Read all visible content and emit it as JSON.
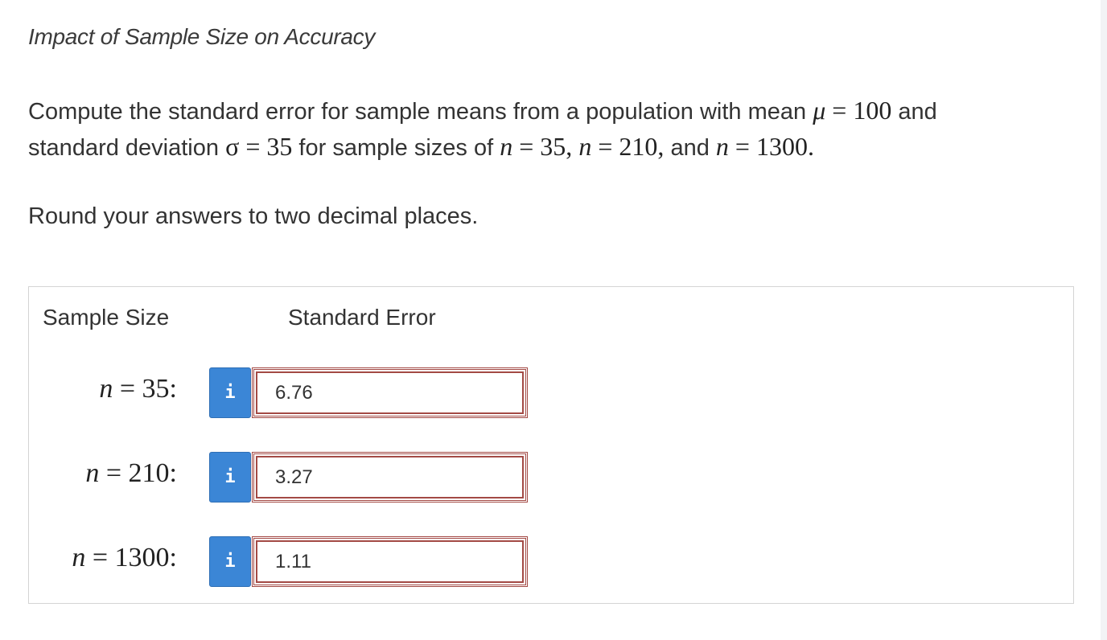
{
  "title": "Impact of Sample Size on Accuracy",
  "problem": {
    "line1": {
      "text": "Compute the standard error for sample means from a population with mean",
      "mu": "μ",
      "eq": "=",
      "mu_value": "100",
      "and": "and"
    },
    "line2": {
      "text": "standard deviation",
      "sigma": "σ",
      "eq": "=",
      "sigma_value": "35",
      "mid": "for sample sizes of",
      "n1": "n",
      "n1_value": "35,",
      "n2": "n",
      "n2_value": "210,",
      "and": "and",
      "n3": "n",
      "n3_value": "1300."
    },
    "instruction": "Round your answers to two decimal places."
  },
  "table": {
    "header_sample_size": "Sample Size",
    "header_standard_error": "Standard Error",
    "rows": [
      {
        "n_symbol": "n",
        "eq": "=",
        "n_value": "35:",
        "info_icon": "i",
        "answer": "6.76"
      },
      {
        "n_symbol": "n",
        "eq": "=",
        "n_value": "210:",
        "info_icon": "i",
        "answer": "3.27"
      },
      {
        "n_symbol": "n",
        "eq": "=",
        "n_value": "1300:",
        "info_icon": "i",
        "answer": "1.11"
      }
    ]
  },
  "colors": {
    "info_button": "#3b86d6",
    "answer_border": "#a34a45",
    "panel_border": "#d4d4d4",
    "text": "#333333"
  }
}
